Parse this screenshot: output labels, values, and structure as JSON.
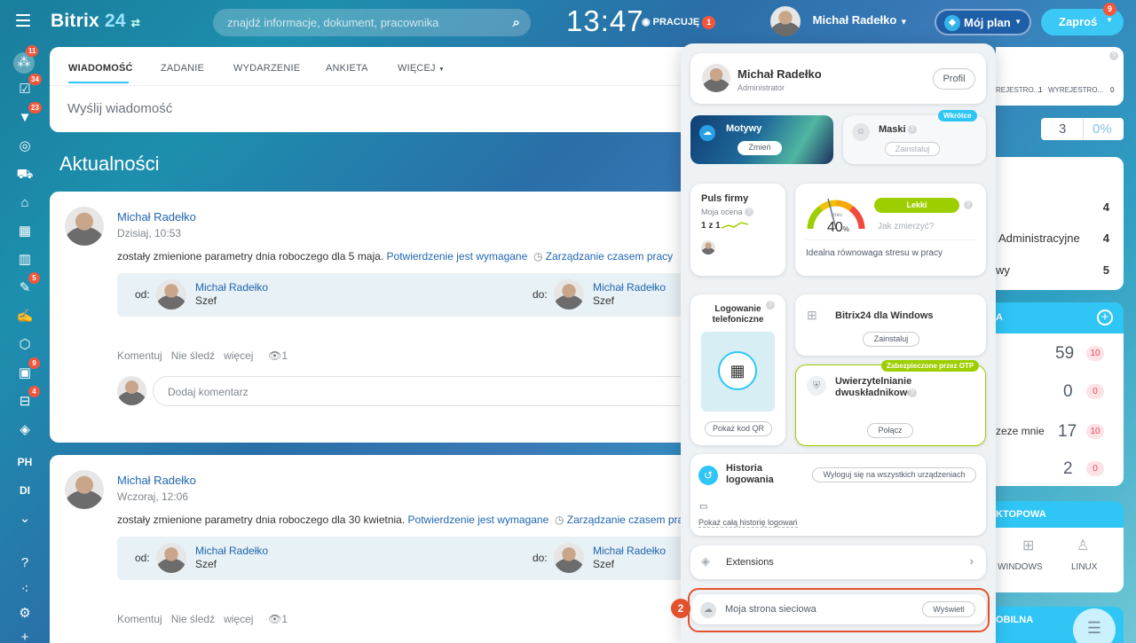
{
  "topbar": {
    "logo_a": "Bitrix",
    "logo_b": "24",
    "search_placeholder": "znajdź informacje, dokument, pracownika",
    "clock": "13:47",
    "work_status": "PRACUJĘ",
    "work_badge": "1",
    "user_name": "Michał Radełko",
    "plan_label": "Mój plan",
    "invite_label": "Zaproś",
    "invite_badge": "9"
  },
  "sidebar": {
    "badges": {
      "b1": "11",
      "b2": "34",
      "b3": "23",
      "b7": "5",
      "b10": "9",
      "b11": "4"
    },
    "text_items": [
      "PH",
      "DI"
    ]
  },
  "composer": {
    "tabs": [
      "WIADOMOŚĆ",
      "ZADANIE",
      "WYDARZENIE",
      "ANKIETA",
      "WIĘCEJ"
    ],
    "placeholder": "Wyślij wiadomość"
  },
  "feed_title": "Aktualności",
  "posts": [
    {
      "author": "Michał Radełko",
      "time": "Dzisiaj, 10:53",
      "text": "zostały zmienione parametry dnia roboczego dla 5 maja.",
      "confirm": "Potwierdzenie jest wymagane",
      "tm": "Zarządzanie czasem pracy",
      "from_label": "od:",
      "to_label": "do:",
      "from_name": "Michał Radełko",
      "from_role": "Szef",
      "to_name": "Michał Radełko",
      "to_role": "Szef",
      "actions": [
        "Komentuj",
        "Nie śledź",
        "więcej"
      ],
      "views": "1",
      "comment_placeholder": "Dodaj komentarz"
    },
    {
      "author": "Michał Radełko",
      "time": "Wczoraj, 12:06",
      "text": "zostały zmienione parametry dnia roboczego dla 30 kwietnia.",
      "confirm": "Potwierdzenie jest wymagane",
      "tm": "Zarządzanie czasem pra",
      "from_label": "od:",
      "to_label": "do:",
      "from_name": "Michał Radełko",
      "from_role": "Szef",
      "to_name": "Michał Radełko",
      "to_role": "Szef",
      "actions": [
        "Komentuj",
        "Nie śledź",
        "więcej"
      ],
      "views": "1"
    }
  ],
  "popup": {
    "name": "Michał Radełko",
    "role": "Administrator",
    "profile_btn": "Profil",
    "themes": "Motywy",
    "themes_btn": "Zmień",
    "masks": "Maski",
    "masks_btn": "Zainstaluj",
    "soon": "Wkrótce",
    "pulse_title": "Puls firmy",
    "pulse_sub": "Moja ocena",
    "pulse_val": "1 z 1",
    "stress_label": "stres",
    "stress_val": "40",
    "stress_unit": "%",
    "stress_level": "Lekki",
    "stress_how": "Jak zmierzyć?",
    "stress_desc": "Idealna równowaga stresu w pracy",
    "phone_login": "Logowanie telefoniczne",
    "qr_btn": "Pokaż kod QR",
    "windows_app": "Bitrix24 dla Windows",
    "windows_btn": "Zainstaluj",
    "otp_tag": "Zabezpieczone przez OTP",
    "twofa": "Uwierzytelnianie dwuskładnikowe",
    "twofa_btn": "Połącz",
    "history": "Historia logowania",
    "logout_all": "Wyloguj się na wszystkich urządzeniach",
    "show_history": "Pokaż całą historię logowań",
    "extensions": "Extensions",
    "network": "Moja strona sieciowa",
    "network_btn": "Wyświetl",
    "step": "2"
  },
  "right": {
    "reg1": "REJESTRO...",
    "reg1_val": "1",
    "reg2": "WYREJESTRO...",
    "reg2_val": "0",
    "count": "3",
    "pct": "0%",
    "list": [
      {
        "label": "",
        "val": "4"
      },
      {
        "label": "Administracyjne",
        "val": "4"
      },
      {
        "label": "wy",
        "val": "5"
      }
    ],
    "tasks_head": "A",
    "tasks": [
      {
        "label": "",
        "val": "59",
        "badge": "10"
      },
      {
        "label": "",
        "val": "0",
        "badge": "0"
      },
      {
        "label": "zeze mnie",
        "val": "17",
        "badge": "10"
      },
      {
        "label": "",
        "val": "2",
        "badge": "0"
      }
    ],
    "desktop_head": "KTOPOWA",
    "win": "WINDOWS",
    "linux": "LINUX",
    "mobile_head": "OBILNA"
  }
}
